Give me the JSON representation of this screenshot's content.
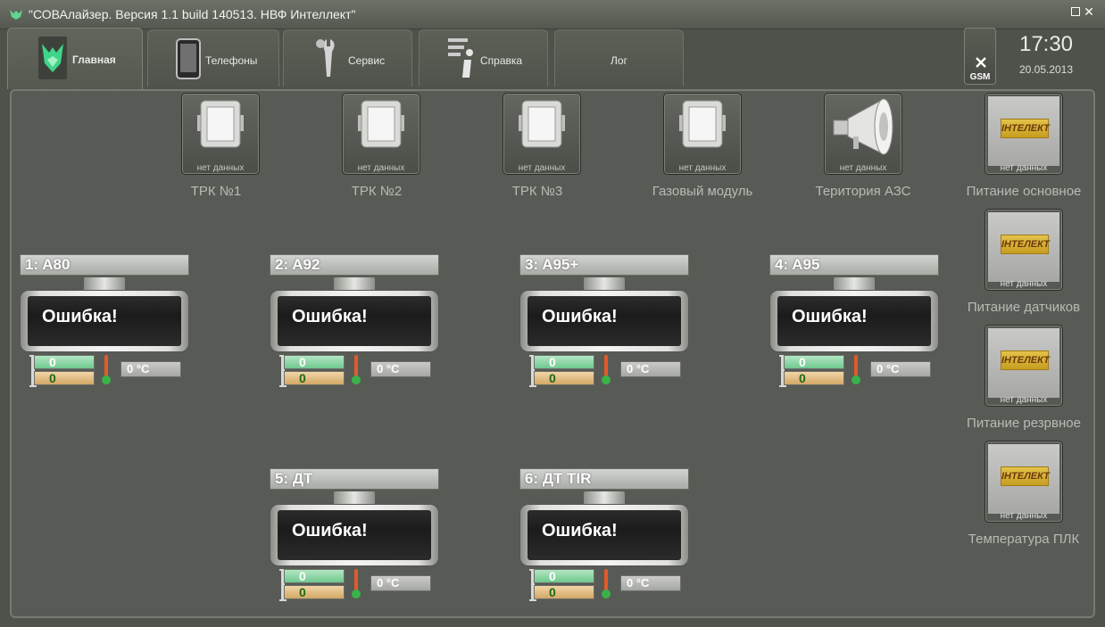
{
  "window": {
    "title": "\"СОВАлайзер. Версия 1.1 build 140513. НВФ Интеллект\""
  },
  "tabs": [
    {
      "label": "Главная",
      "icon": "owl-icon",
      "active": true
    },
    {
      "label": "Телефоны",
      "icon": "tablet-icon",
      "active": false
    },
    {
      "label": "Сервис",
      "icon": "tools-icon",
      "active": false
    },
    {
      "label": "Справка",
      "icon": "info-icon",
      "active": false
    },
    {
      "label": "Лог",
      "icon": "",
      "active": false
    }
  ],
  "gsm": {
    "label": "GSM",
    "icon": "gsm-off-icon"
  },
  "clock": {
    "time": "17:30",
    "date": "20.05.2013"
  },
  "devices": [
    {
      "caption": "ТРК №1",
      "status": "нет данных",
      "icon": "dispenser-icon"
    },
    {
      "caption": "ТРК №2",
      "status": "нет данных",
      "icon": "dispenser-icon"
    },
    {
      "caption": "ТРК №3",
      "status": "нет данных",
      "icon": "dispenser-icon"
    },
    {
      "caption": "Газовый модуль",
      "status": "нет данных",
      "icon": "dispenser-icon"
    },
    {
      "caption": "Територия АЗС",
      "status": "нет данных",
      "icon": "loudspeaker-icon"
    }
  ],
  "power": [
    {
      "caption": "Питание основное",
      "status": "нет данных",
      "logo": "ІНТЕЛЕКТ"
    },
    {
      "caption": "Питание датчиков",
      "status": "нет данных",
      "logo": "ІНТЕЛЕКТ"
    },
    {
      "caption": "Питание резрвное",
      "status": "нет данных",
      "logo": "ІНТЕЛЕКТ"
    },
    {
      "caption": "Температура ПЛК",
      "status": "нет данных",
      "logo": "ІНТЕЛЕКТ"
    }
  ],
  "tanks": [
    {
      "label": "1: A80",
      "status": "Ошибка!",
      "level1": "0",
      "level2": "0",
      "temp": "0 °C"
    },
    {
      "label": "2: A92",
      "status": "Ошибка!",
      "level1": "0",
      "level2": "0",
      "temp": "0 °C"
    },
    {
      "label": "3: A95+",
      "status": "Ошибка!",
      "level1": "0",
      "level2": "0",
      "temp": "0 °C"
    },
    {
      "label": "4: A95",
      "status": "Ошибка!",
      "level1": "0",
      "level2": "0",
      "temp": "0 °C"
    },
    {
      "label": "5: ДТ",
      "status": "Ошибка!",
      "level1": "0",
      "level2": "0",
      "temp": "0 °C"
    },
    {
      "label": "6: ДТ TIR",
      "status": "Ошибка!",
      "level1": "0",
      "level2": "0",
      "temp": "0 °C"
    }
  ],
  "colors": {
    "background": "#4f524b",
    "panel": "#585b55",
    "level_top": "#6fc88e",
    "level_bottom": "#d3a766",
    "logo": "#c79d20"
  }
}
